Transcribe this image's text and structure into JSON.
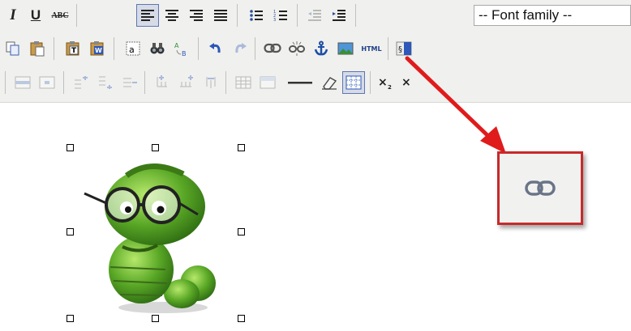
{
  "editor": {
    "toolbar": {
      "font_family_placeholder": "-- Font family --",
      "italic_label": "I",
      "underline_label": "U",
      "strikethrough_label": "ABC",
      "html_label": "HTML"
    }
  },
  "colors": {
    "toolbar_bg": "#f0f0ee",
    "callout_border": "#c72a2a",
    "arrow": "#e01b1b",
    "active_button_border": "#5d77b3"
  },
  "icons": {
    "row1": [
      "italic-icon",
      "underline-icon",
      "strikethrough-icon",
      "align-left-icon",
      "align-center-icon",
      "align-right-icon",
      "align-justify-icon",
      "unordered-list-icon",
      "ordered-list-icon",
      "outdent-icon",
      "indent-icon"
    ],
    "row2": [
      "copy-icon",
      "paste-icon",
      "paste-text-icon",
      "paste-word-icon",
      "select-all-icon",
      "find-icon",
      "replace-icon",
      "undo-icon",
      "redo-icon",
      "link-icon",
      "unlink-icon",
      "anchor-icon",
      "image-icon",
      "html-icon",
      "special-char-icon"
    ],
    "row3": [
      "row-props-icon",
      "cell-props-icon",
      "insert-row-before-icon",
      "insert-row-after-icon",
      "delete-row-icon",
      "insert-col-before-icon",
      "insert-col-after-icon",
      "delete-col-icon",
      "split-cells-icon",
      "merge-cells-icon",
      "horizontal-rule-icon",
      "remove-format-icon",
      "visual-aid-icon",
      "subscript-icon"
    ]
  },
  "canvas": {
    "image": "bookworm-with-glasses",
    "callout_icon": "link-icon"
  }
}
